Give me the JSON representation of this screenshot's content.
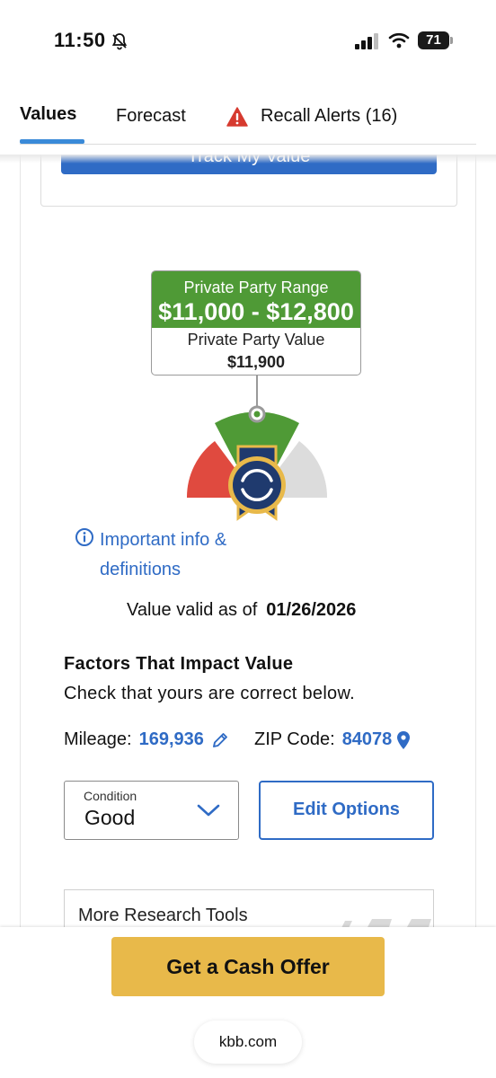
{
  "status_bar": {
    "time": "11:50",
    "battery": "71",
    "icons": [
      "bell-slash-icon",
      "signal-icon",
      "wifi-icon",
      "battery-icon"
    ]
  },
  "tabs": [
    {
      "label": "Values",
      "active": true
    },
    {
      "label": "Forecast",
      "active": false
    },
    {
      "label": "Recall Alerts (16)",
      "active": false,
      "icon": "warning-icon"
    }
  ],
  "track_button": {
    "label": "Track My Value"
  },
  "valuation": {
    "range_label": "Private Party Range",
    "range_value": "$11,000 - $12,800",
    "value_label": "Private Party Value",
    "value": "$11,900"
  },
  "info_link": {
    "label": "Important info & definitions",
    "icon": "info-icon"
  },
  "valid": {
    "label": "Value valid as of",
    "date": "01/26/2026"
  },
  "factors": {
    "title": "Factors That Impact Value",
    "subtitle": "Check that yours are correct below.",
    "mileage_label": "Mileage:",
    "mileage_value": "169,936",
    "zip_label": "ZIP Code:",
    "zip_value": "84078"
  },
  "condition": {
    "label": "Condition",
    "value": "Good"
  },
  "edit_options": {
    "label": "Edit Options"
  },
  "research": {
    "title": "More Research Tools"
  },
  "cash_offer": {
    "label": "Get a Cash Offer"
  },
  "browser": {
    "url": "kbb.com"
  },
  "colors": {
    "accent_blue": "#2f6bc5",
    "range_green": "#4f9a36",
    "cta_yellow": "#e8b94a",
    "gauge_red": "#e04a3f",
    "gauge_gray": "#dcdcdc"
  }
}
